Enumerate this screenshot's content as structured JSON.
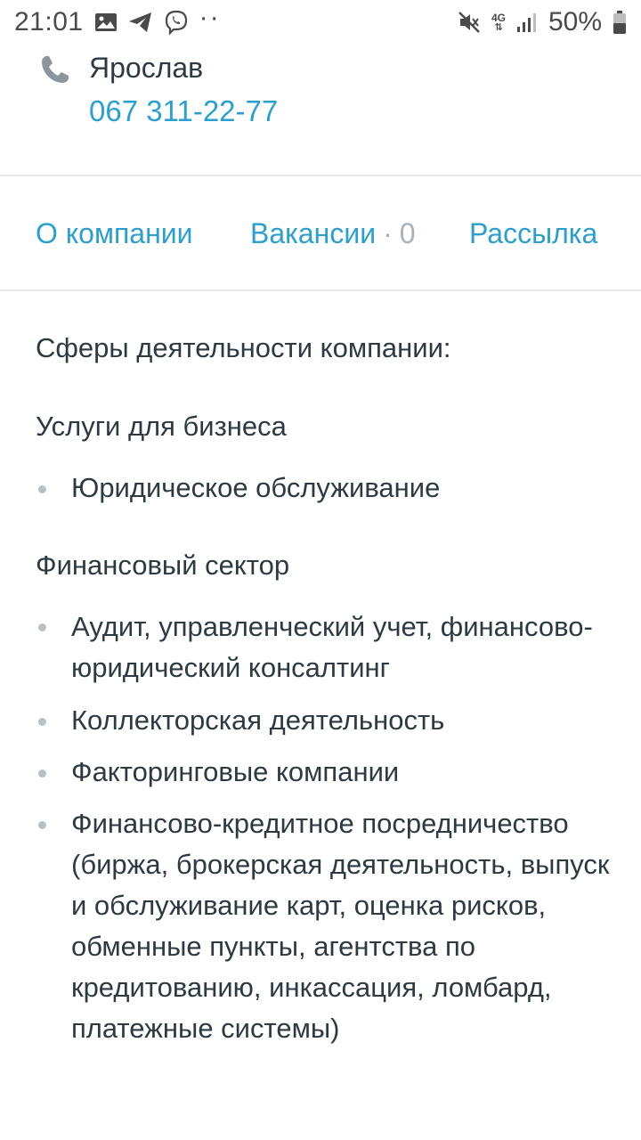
{
  "status_bar": {
    "time": "21:01",
    "battery": "50%",
    "network": "4G",
    "icons": [
      "gallery-icon",
      "telegram-icon",
      "viber-icon",
      "more-dots-icon",
      "mute-icon",
      "signal-icon",
      "battery-icon"
    ]
  },
  "contact": {
    "name": "Ярослав",
    "phone": "067 311-22-77",
    "icon": "phone-icon"
  },
  "tabs": {
    "about": "О компании",
    "vacancies": "Вакансии",
    "vacancies_sep": "·",
    "vacancies_count": "0",
    "mailing": "Рассылка"
  },
  "content": {
    "title": "Сферы деятельности компании:",
    "sections": [
      {
        "heading": "Услуги для бизнеса",
        "items": [
          "Юридическое обслуживание"
        ]
      },
      {
        "heading": "Финансовый сектор",
        "items": [
          "Аудит, управленческий учет, финансово-юридический консалтинг",
          "Коллекторская деятельность",
          "Факторинговые компании",
          "Финансово-кредитное посредничество (биржа, брокерская деятельность, выпуск и обслуживание карт, оценка рисков, обменные пункты, агентства по кредитованию, инкассация, ломбард, платежные системы)"
        ]
      }
    ]
  },
  "colors": {
    "link": "#2a9fd0",
    "text": "#2d3a44",
    "muted": "#a8b2ba",
    "divider": "#e6e9ec",
    "bullet": "#b8bfc5"
  }
}
